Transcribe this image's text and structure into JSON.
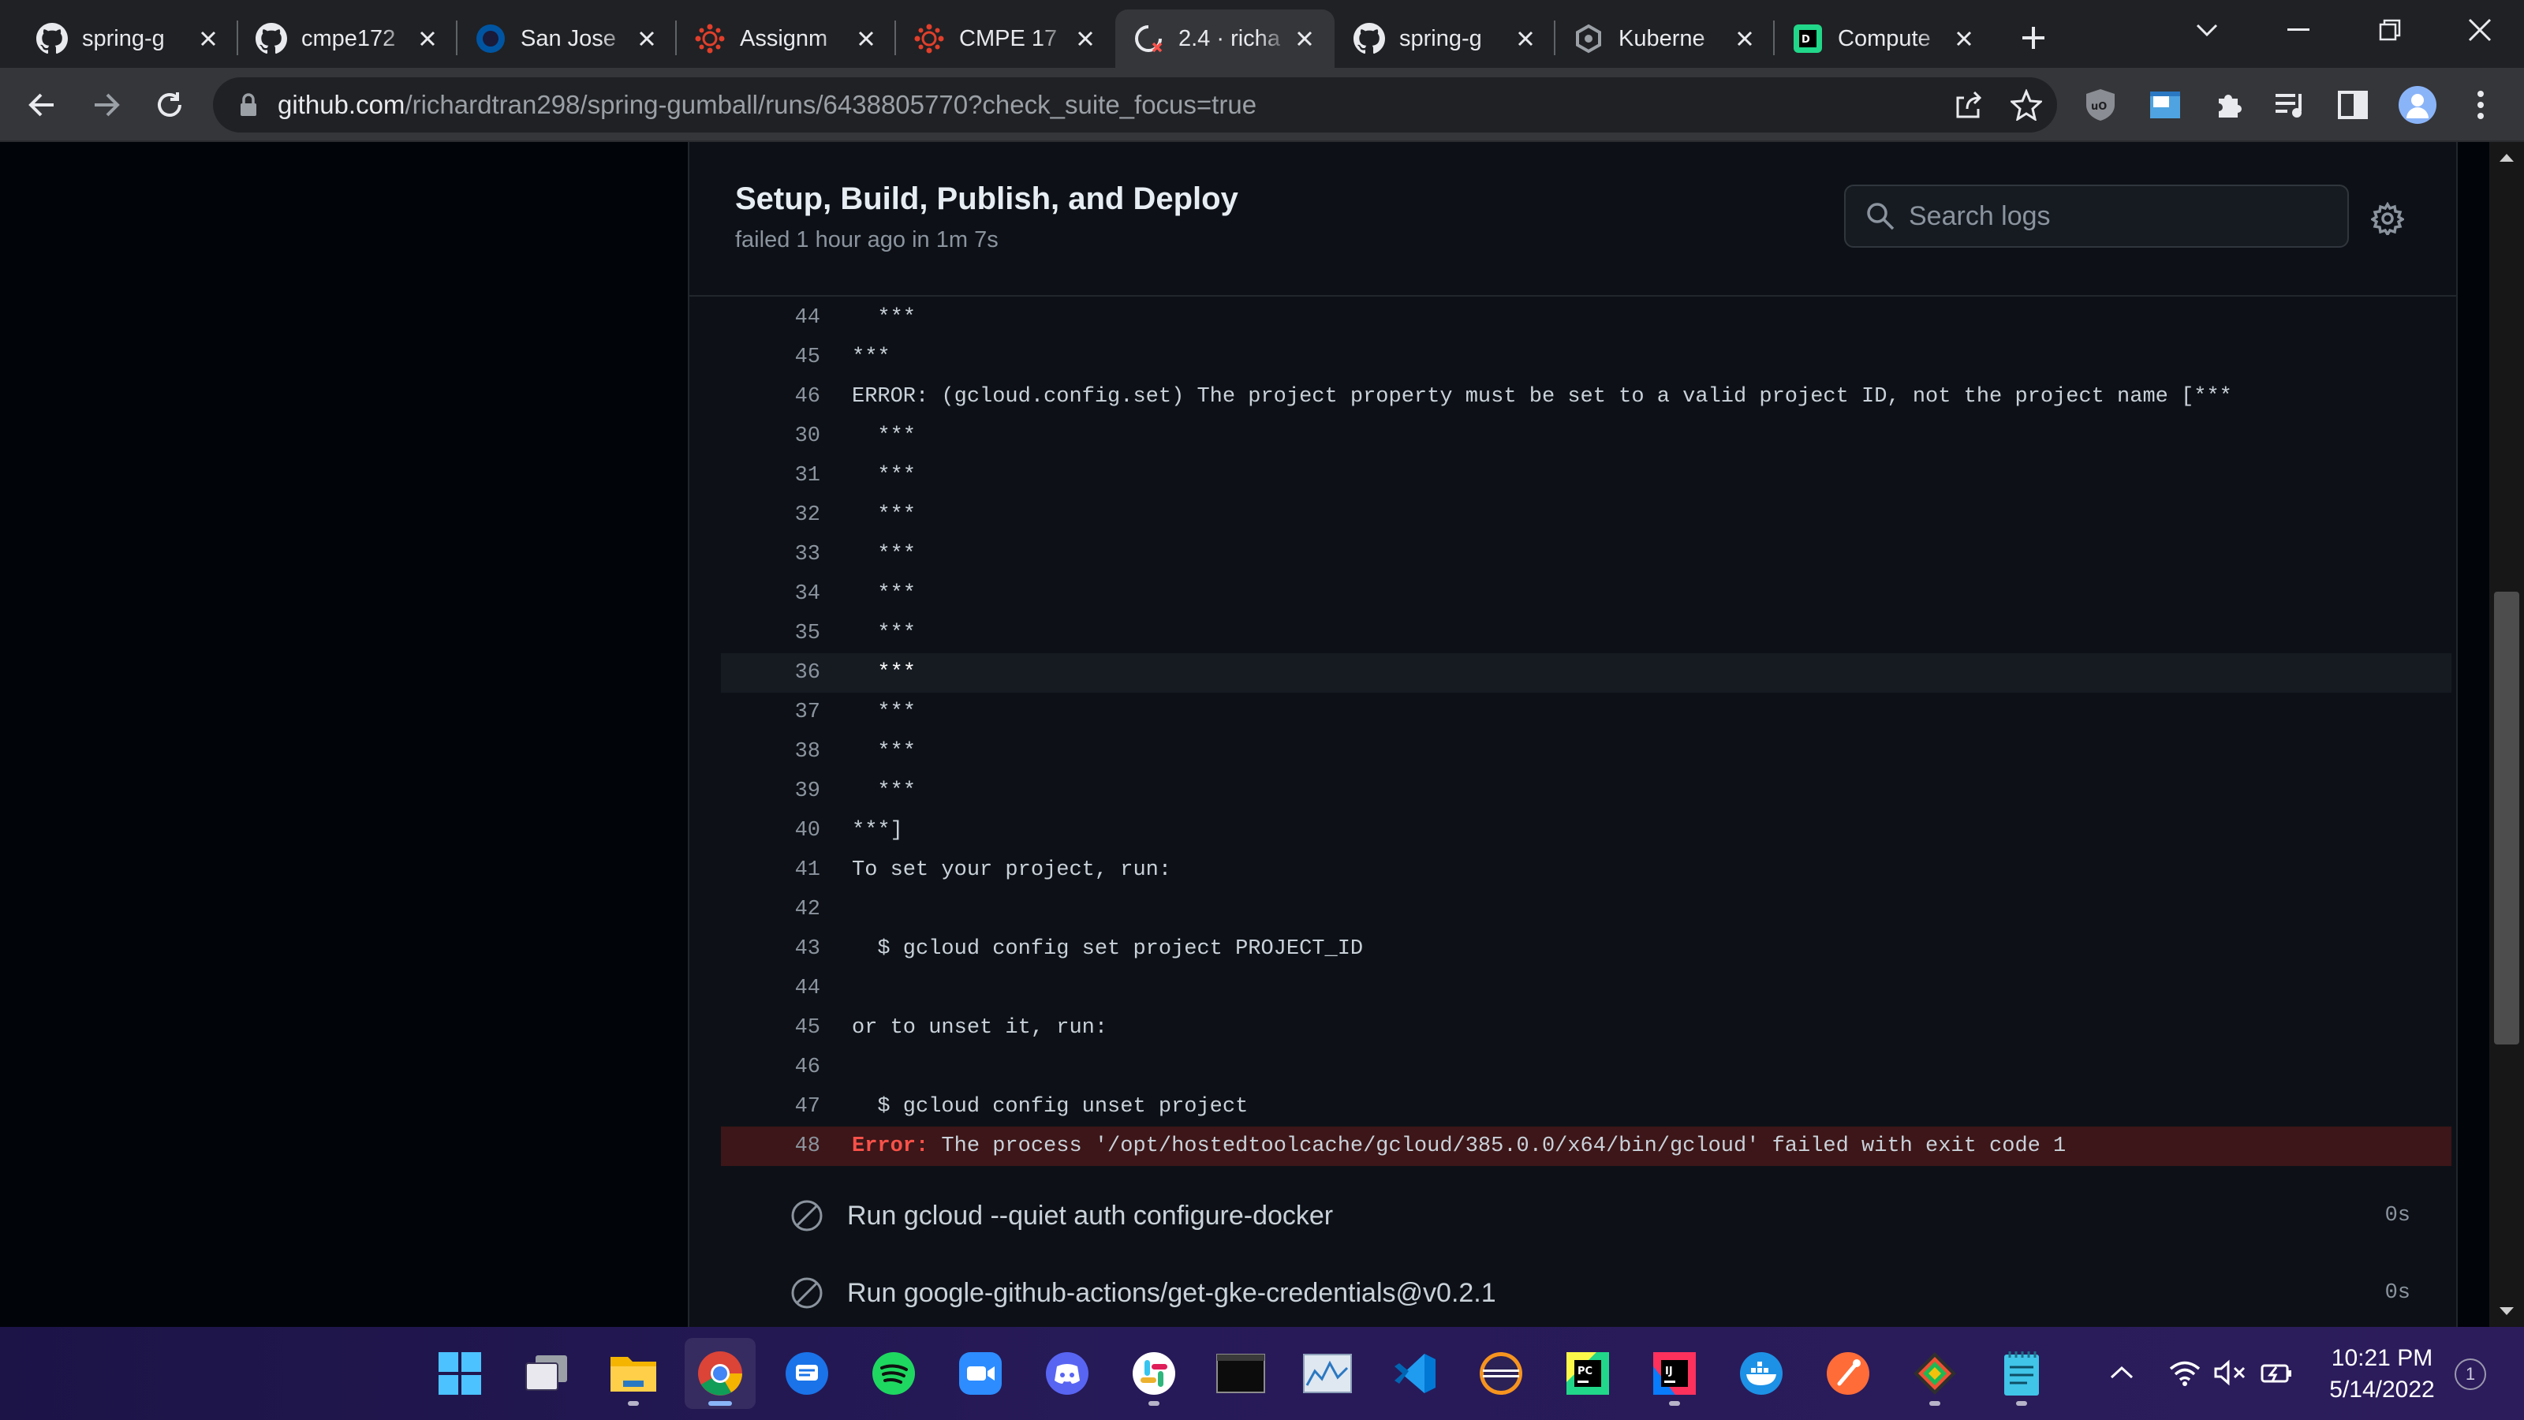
{
  "browser": {
    "tabs": [
      {
        "title": "spring-g",
        "icon": "github-icon"
      },
      {
        "title": "cmpe172",
        "icon": "github-icon"
      },
      {
        "title": "San Jose",
        "icon": "sjsu-icon"
      },
      {
        "title": "Assignm",
        "icon": "canvas-icon"
      },
      {
        "title": "CMPE 17",
        "icon": "canvas-icon"
      },
      {
        "title": "2.4 · richa",
        "icon": "github-actions-failed-icon",
        "active": true
      },
      {
        "title": "spring-g",
        "icon": "github-icon"
      },
      {
        "title": "Kuberne",
        "icon": "gcp-icon"
      },
      {
        "title": "Compute",
        "icon": "pycharm-icon"
      }
    ],
    "url_host": "github.com",
    "url_path": "/richardtran298/spring-gumball/runs/6438805770?check_suite_focus=true",
    "ublock_label": "uO"
  },
  "job": {
    "title": "Setup, Build, Publish, and Deploy",
    "subtitle": "failed 1 hour ago in 1m 7s",
    "search_placeholder": "Search logs"
  },
  "log_lines": [
    {
      "num": "44",
      "text": "  ***"
    },
    {
      "num": "45",
      "text": "***"
    },
    {
      "num": "46",
      "text": "ERROR: (gcloud.config.set) The project property must be set to a valid project ID, not the project name [***"
    },
    {
      "num": "30",
      "text": "  ***"
    },
    {
      "num": "31",
      "text": "  ***"
    },
    {
      "num": "32",
      "text": "  ***"
    },
    {
      "num": "33",
      "text": "  ***"
    },
    {
      "num": "34",
      "text": "  ***"
    },
    {
      "num": "35",
      "text": "  ***"
    },
    {
      "num": "36",
      "text": "  ***",
      "highlight": true
    },
    {
      "num": "37",
      "text": "  ***"
    },
    {
      "num": "38",
      "text": "  ***"
    },
    {
      "num": "39",
      "text": "  ***"
    },
    {
      "num": "40",
      "text": "***]"
    },
    {
      "num": "41",
      "text": "To set your project, run:"
    },
    {
      "num": "42",
      "text": ""
    },
    {
      "num": "43",
      "text": "  $ gcloud config set project PROJECT_ID"
    },
    {
      "num": "44",
      "text": ""
    },
    {
      "num": "45",
      "text": "or to unset it, run:"
    },
    {
      "num": "46",
      "text": ""
    },
    {
      "num": "47",
      "text": "  $ gcloud config unset project"
    }
  ],
  "error_line": {
    "num": "48",
    "label": "Error:",
    "text": " The process '/opt/hostedtoolcache/gcloud/385.0.0/x64/bin/gcloud' failed with exit code 1"
  },
  "steps": [
    {
      "label": "Run gcloud --quiet auth configure-docker",
      "duration": "0s",
      "status": "skipped"
    },
    {
      "label": "Run google-github-actions/get-gke-credentials@v0.2.1",
      "duration": "0s",
      "status": "skipped"
    }
  ],
  "taskbar": {
    "apps": [
      "windows-start-icon",
      "task-view-icon",
      "file-explorer-icon",
      "chrome-icon",
      "messages-icon",
      "spotify-icon",
      "zoom-icon",
      "discord-icon",
      "slack-icon",
      "terminal-icon",
      "resource-monitor-icon",
      "vscode-icon",
      "eclipse-icon",
      "pycharm-icon",
      "intellij-icon",
      "docker-icon",
      "postman-icon",
      "git-icon",
      "notepad-icon"
    ],
    "time": "10:21 PM",
    "date": "5/14/2022",
    "notification_count": "1"
  },
  "colors": {
    "page_bg": "#010409",
    "panel_bg": "#0d1117",
    "error_bg": "#3c1618",
    "error_text": "#f85149",
    "muted": "#8b949e"
  }
}
